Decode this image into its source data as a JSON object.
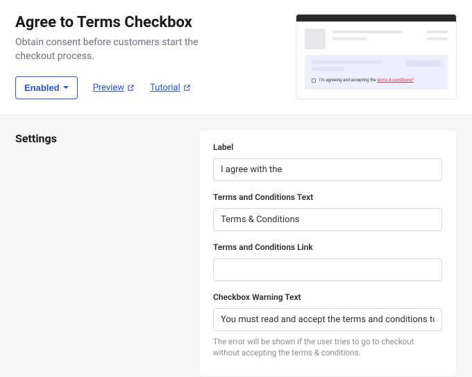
{
  "header": {
    "title": "Agree to Terms Checkbox",
    "subtitle": "Obtain consent before customers start the checkout process.",
    "enabled_label": "Enabled",
    "preview_label": "Preview",
    "tutorial_label": "Tutorial"
  },
  "preview": {
    "consent_prefix": "I'm agreeing and accepting the ",
    "consent_link": "terms & conditions*"
  },
  "settings": {
    "section_title": "Settings",
    "fields": {
      "label": {
        "label": "Label",
        "value": "I agree with the"
      },
      "tc_text": {
        "label": "Terms and Conditions Text",
        "value": "Terms & Conditions"
      },
      "tc_link": {
        "label": "Terms and Conditions Link",
        "value": ""
      },
      "warning": {
        "label": "Checkbox Warning Text",
        "value": "You must read and accept the terms and conditions to complete checkout",
        "helper": "The error will be shown if the user tries to go to checkout without accepting the terms & conditions."
      }
    }
  }
}
